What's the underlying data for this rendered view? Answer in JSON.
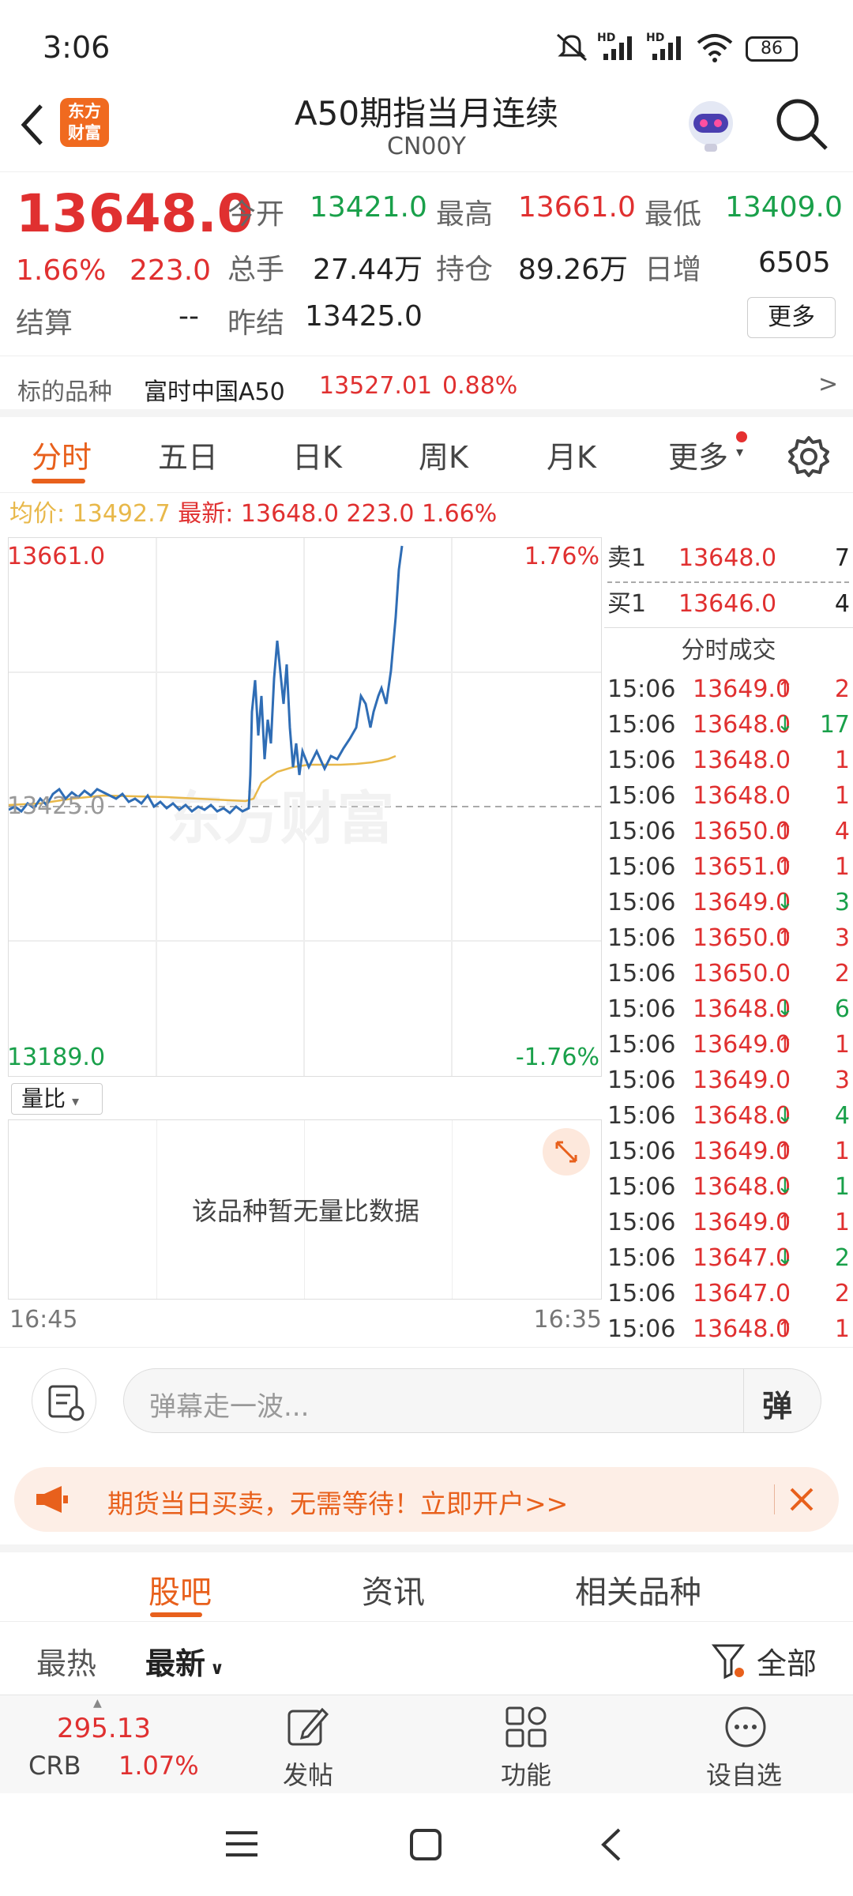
{
  "status": {
    "time": "3:06",
    "battery": "86",
    "net1": "HD",
    "net2": "HD"
  },
  "header": {
    "title": "A50期指当月连续",
    "code": "CN00Y",
    "logo_line1": "东方",
    "logo_line2": "财富"
  },
  "quote": {
    "price": "13648.0",
    "pct": "1.66%",
    "chg": "223.0",
    "open_label": "今开",
    "open": "13421.0",
    "high_label": "最高",
    "high": "13661.0",
    "low_label": "最低",
    "low": "13409.0",
    "vol_label": "总手",
    "vol": "27.44万",
    "oi_label": "持仓",
    "oi": "89.26万",
    "inc_label": "日增",
    "inc": "6505",
    "settle_label": "结算",
    "settle": "--",
    "prev_label": "昨结",
    "prev": "13425.0",
    "more": "更多"
  },
  "underlying": {
    "label": "标的品种",
    "name": "富时中国A50",
    "price": "13527.01",
    "pct": "0.88%",
    "arrow": ">"
  },
  "tabs": [
    "分时",
    "五日",
    "日K",
    "周K",
    "月K",
    "更多"
  ],
  "avg": {
    "avg_label": "均价:",
    "avg": "13492.7",
    "last_label": "最新:",
    "last": "13648.0",
    "chg": "223.0",
    "pct": "1.66%"
  },
  "chart": {
    "top_price": "13661.0",
    "top_pct": "1.76%",
    "base_price": "13425.0",
    "bot_price": "13189.0",
    "bot_pct": "-1.76%",
    "watermark": "东方财富"
  },
  "vol": {
    "selector": "量比",
    "nodata": "该品种暂无量比数据",
    "t_start": "16:45",
    "t_end": "16:35"
  },
  "book": {
    "ask_label": "卖1",
    "ask": "13648.0",
    "ask_vol": "7",
    "bid_label": "买1",
    "bid": "13646.0",
    "bid_vol": "4",
    "trades_title": "分时成交",
    "trades": [
      {
        "t": "15:06",
        "p": "13649.0",
        "d": "up",
        "v": "2"
      },
      {
        "t": "15:06",
        "p": "13648.0",
        "d": "down",
        "v": "17"
      },
      {
        "t": "15:06",
        "p": "13648.0",
        "d": "",
        "v": "1"
      },
      {
        "t": "15:06",
        "p": "13648.0",
        "d": "",
        "v": "1"
      },
      {
        "t": "15:06",
        "p": "13650.0",
        "d": "up",
        "v": "4"
      },
      {
        "t": "15:06",
        "p": "13651.0",
        "d": "up",
        "v": "1"
      },
      {
        "t": "15:06",
        "p": "13649.0",
        "d": "down",
        "v": "3"
      },
      {
        "t": "15:06",
        "p": "13650.0",
        "d": "up",
        "v": "3"
      },
      {
        "t": "15:06",
        "p": "13650.0",
        "d": "",
        "v": "2"
      },
      {
        "t": "15:06",
        "p": "13648.0",
        "d": "down",
        "v": "6"
      },
      {
        "t": "15:06",
        "p": "13649.0",
        "d": "up",
        "v": "1"
      },
      {
        "t": "15:06",
        "p": "13649.0",
        "d": "",
        "v": "3"
      },
      {
        "t": "15:06",
        "p": "13648.0",
        "d": "down",
        "v": "4"
      },
      {
        "t": "15:06",
        "p": "13649.0",
        "d": "up",
        "v": "1"
      },
      {
        "t": "15:06",
        "p": "13648.0",
        "d": "down",
        "v": "1"
      },
      {
        "t": "15:06",
        "p": "13649.0",
        "d": "up",
        "v": "1"
      },
      {
        "t": "15:06",
        "p": "13647.0",
        "d": "down",
        "v": "2"
      },
      {
        "t": "15:06",
        "p": "13647.0",
        "d": "",
        "v": "2"
      },
      {
        "t": "15:06",
        "p": "13648.0",
        "d": "up",
        "v": "1"
      }
    ]
  },
  "comment": {
    "placeholder": "弹幕走一波...",
    "danmu": "弹"
  },
  "banner": {
    "text": "期货当日买卖，无需等待！立即开户>>"
  },
  "subtabs": [
    "股吧",
    "资讯",
    "相关品种"
  ],
  "sort": {
    "hot": "最热",
    "new": "最新",
    "filter": "全部"
  },
  "bottomnav": {
    "crb_price": "295.13",
    "crb_label": "CRB",
    "crb_pct": "1.07%",
    "post": "发帖",
    "func": "功能",
    "watch": "设自选"
  },
  "colors": {
    "up": "#e03030",
    "down": "#19a04a",
    "accent": "#e8601c",
    "line": "#2f6db5",
    "avg": "#e8b84a"
  }
}
